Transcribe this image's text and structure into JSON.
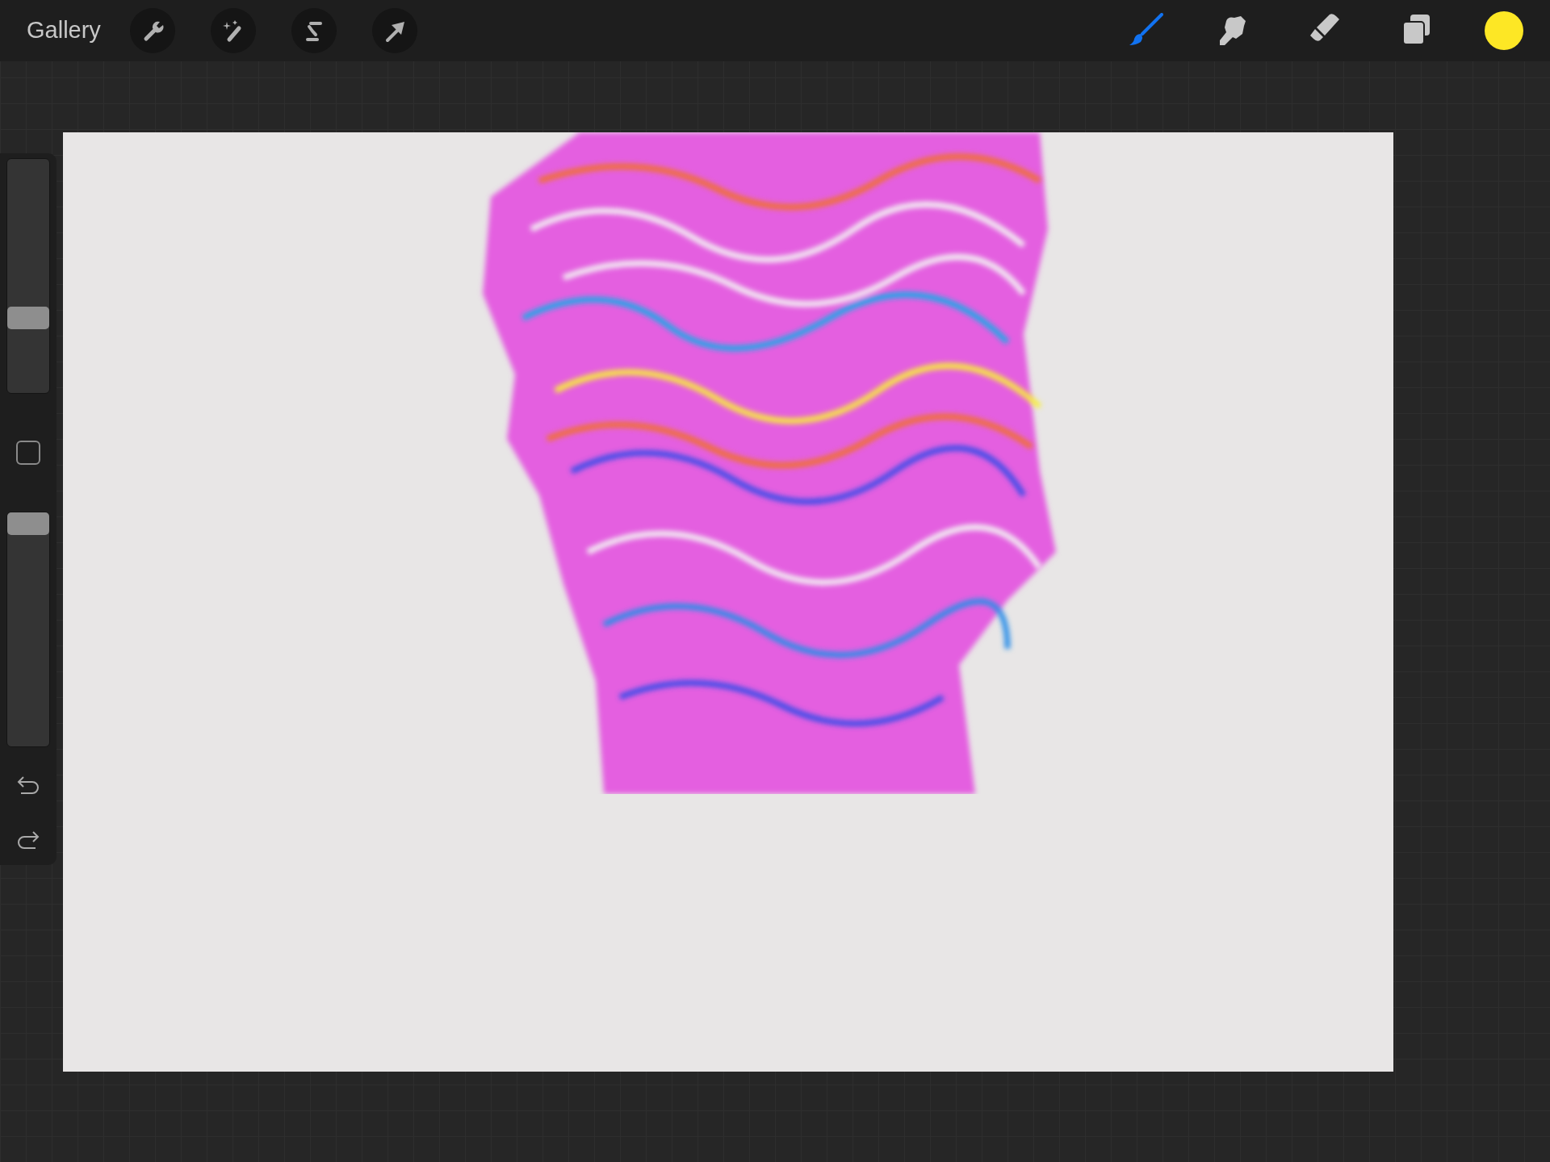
{
  "top_bar": {
    "gallery_label": "Gallery",
    "left_tools": [
      {
        "kind": "wrench"
      },
      {
        "kind": "wand"
      },
      {
        "kind": "selection"
      },
      {
        "kind": "transform"
      }
    ],
    "right_tools": [
      {
        "kind": "brush",
        "selected": true
      },
      {
        "kind": "smudge",
        "selected": false
      },
      {
        "kind": "eraser",
        "selected": false
      },
      {
        "kind": "layers",
        "selected": false
      }
    ],
    "color": "#fde725"
  },
  "sidebar": {
    "sliders": [
      {
        "level": 0.3
      },
      {
        "level": 1
      }
    ]
  }
}
